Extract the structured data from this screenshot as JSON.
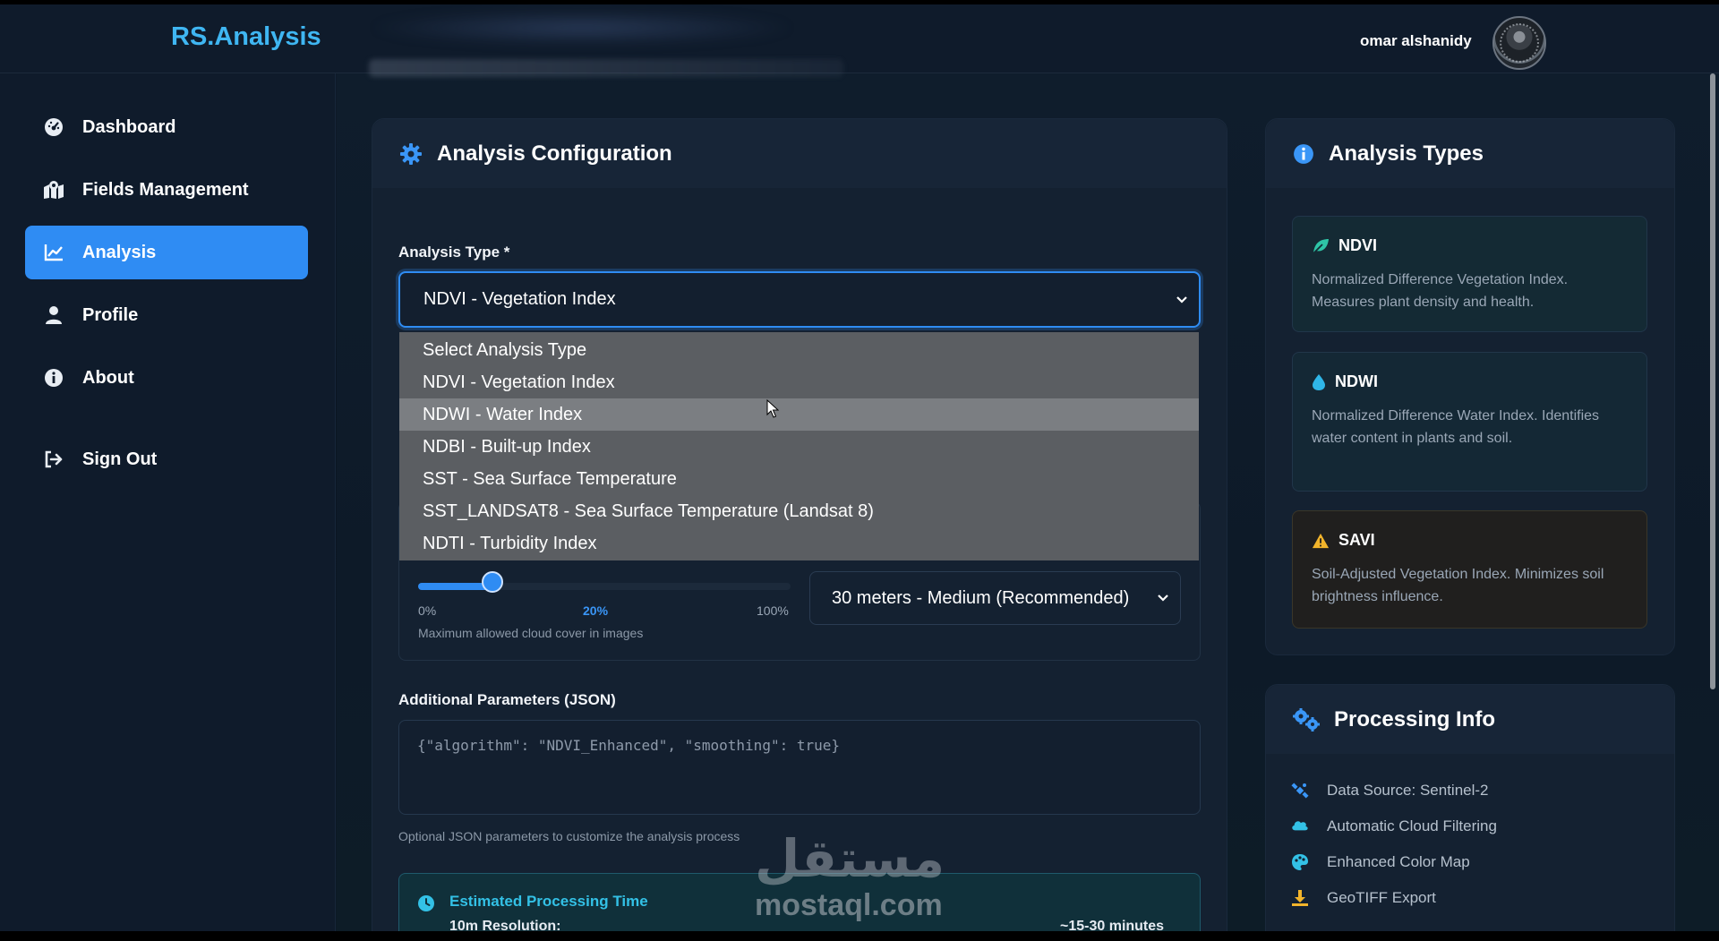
{
  "header": {
    "brand": "RS.Analysis",
    "username": "omar alshanidy"
  },
  "sidebar": {
    "items": [
      {
        "label": "Dashboard",
        "icon": "dashboard-gauge-icon"
      },
      {
        "label": "Fields Management",
        "icon": "map-marker-icon"
      },
      {
        "label": "Analysis",
        "icon": "line-chart-icon",
        "active": true
      },
      {
        "label": "Profile",
        "icon": "user-icon"
      },
      {
        "label": "About",
        "icon": "info-circle-icon"
      },
      {
        "label": "Sign Out",
        "icon": "sign-out-icon"
      }
    ]
  },
  "config": {
    "title": "Analysis Configuration",
    "analysis_type_label": "Analysis Type *",
    "analysis_type_value": "NDVI - Vegetation Index",
    "dropdown_options": [
      "Select Analysis Type",
      "NDVI - Vegetation Index",
      "NDWI - Water Index",
      "NDBI - Built-up Index",
      "SST - Sea Surface Temperature",
      "SST_LANDSAT8 - Sea Surface Temperature (Landsat 8)",
      "NDTI - Turbidity Index"
    ],
    "dropdown_hovered_index": 2,
    "cloud": {
      "min_label": "0%",
      "current_label": "20%",
      "max_label": "100%",
      "value_percent": 20,
      "helper": "Maximum allowed cloud cover in images"
    },
    "resolution_value": "30 meters - Medium (Recommended)",
    "params_label": "Additional Parameters (JSON)",
    "params_placeholder": "{\"algorithm\": \"NDVI_Enhanced\", \"smoothing\": true}",
    "params_helper": "Optional JSON parameters to customize the analysis process",
    "estimate": {
      "title": "Estimated Processing Time",
      "row_label": "10m Resolution:",
      "row_value": "~15-30 minutes"
    }
  },
  "types": {
    "title": "Analysis Types",
    "items": [
      {
        "name": "NDVI",
        "desc": "Normalized Difference Vegetation Index. Measures plant density and health.",
        "icon": "leaf-icon",
        "color": "#2ec4a6"
      },
      {
        "name": "NDWI",
        "desc": "Normalized Difference Water Index. Identifies water content in plants and soil.",
        "icon": "water-drop-icon",
        "color": "#2fb6e8"
      },
      {
        "name": "SAVI",
        "desc": "Soil-Adjusted Vegetation Index. Minimizes soil brightness influence.",
        "icon": "warning-icon",
        "color": "#f2b42b"
      }
    ]
  },
  "processing": {
    "title": "Processing Info",
    "items": [
      {
        "label": "Data Source: Sentinel-2",
        "icon": "satellite-icon"
      },
      {
        "label": "Automatic Cloud Filtering",
        "icon": "cloud-icon"
      },
      {
        "label": "Enhanced Color Map",
        "icon": "palette-icon"
      },
      {
        "label": "GeoTIFF Export",
        "icon": "download-icon"
      }
    ]
  },
  "watermark": {
    "arabic": "مستقل",
    "latin": "mostaql.com"
  },
  "colors": {
    "accent": "#2f8cf3",
    "brand": "#3fb6f2",
    "sidebar_bg": "#0f1b2b"
  }
}
